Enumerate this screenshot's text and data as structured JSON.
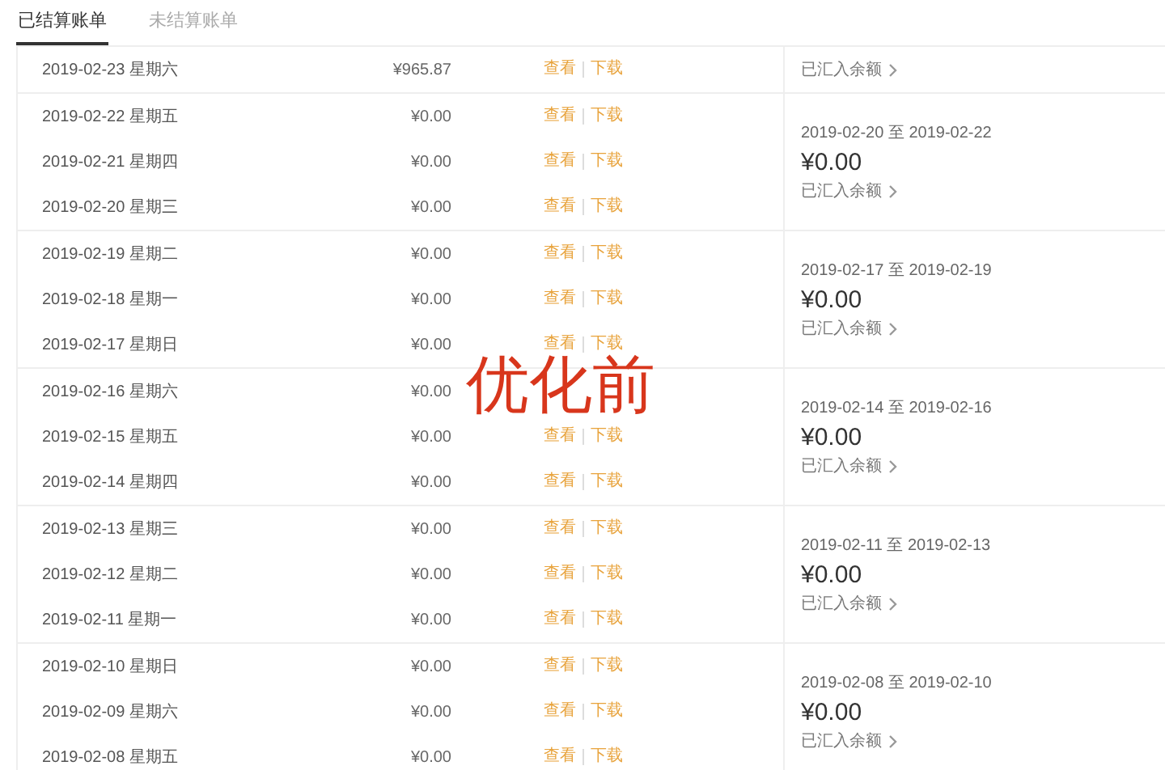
{
  "tabs": [
    {
      "label": "已结算账单",
      "selected": true
    },
    {
      "label": "未结算账单",
      "selected": false
    }
  ],
  "groups": [
    {
      "days": [
        {
          "date": "2019-02-23 星期六",
          "amount": "¥965.87",
          "actions": [
            "查看",
            "下载"
          ]
        }
      ],
      "summary": {
        "link": "已汇入余额"
      }
    },
    {
      "days": [
        {
          "date": "2019-02-22 星期五",
          "amount": "¥0.00",
          "actions": [
            "查看",
            "下载"
          ]
        },
        {
          "date": "2019-02-21 星期四",
          "amount": "¥0.00",
          "actions": [
            "查看",
            "下载"
          ]
        },
        {
          "date": "2019-02-20 星期三",
          "amount": "¥0.00",
          "actions": [
            "查看",
            "下载"
          ]
        }
      ],
      "summary": {
        "range": "2019-02-20 至 2019-02-22",
        "amount": "¥0.00",
        "link": "已汇入余额"
      }
    },
    {
      "days": [
        {
          "date": "2019-02-19 星期二",
          "amount": "¥0.00",
          "actions": [
            "查看",
            "下载"
          ]
        },
        {
          "date": "2019-02-18 星期一",
          "amount": "¥0.00",
          "actions": [
            "查看",
            "下载"
          ]
        },
        {
          "date": "2019-02-17 星期日",
          "amount": "¥0.00",
          "actions": [
            "查看",
            "下载"
          ]
        }
      ],
      "summary": {
        "range": "2019-02-17 至 2019-02-19",
        "amount": "¥0.00",
        "link": "已汇入余额"
      }
    },
    {
      "days": [
        {
          "date": "2019-02-16 星期六",
          "amount": "¥0.00"
        },
        {
          "date": "2019-02-15 星期五",
          "amount": "¥0.00",
          "actions": [
            "查看",
            "下载"
          ]
        },
        {
          "date": "2019-02-14 星期四",
          "amount": "¥0.00",
          "actions": [
            "查看",
            "下载"
          ]
        }
      ],
      "summary": {
        "range": "2019-02-14 至 2019-02-16",
        "amount": "¥0.00",
        "link": "已汇入余额"
      }
    },
    {
      "days": [
        {
          "date": "2019-02-13 星期三",
          "amount": "¥0.00",
          "actions": [
            "查看",
            "下载"
          ]
        },
        {
          "date": "2019-02-12 星期二",
          "amount": "¥0.00",
          "actions": [
            "查看",
            "下载"
          ]
        },
        {
          "date": "2019-02-11 星期一",
          "amount": "¥0.00",
          "actions": [
            "查看",
            "下载"
          ]
        }
      ],
      "summary": {
        "range": "2019-02-11 至 2019-02-13",
        "amount": "¥0.00",
        "link": "已汇入余额"
      }
    },
    {
      "days": [
        {
          "date": "2019-02-10 星期日",
          "amount": "¥0.00",
          "actions": [
            "查看",
            "下载"
          ]
        },
        {
          "date": "2019-02-09 星期六",
          "amount": "¥0.00",
          "actions": [
            "查看",
            "下载"
          ]
        },
        {
          "date": "2019-02-08 星期五",
          "amount": "¥0.00",
          "actions": [
            "查看",
            "下载"
          ]
        }
      ],
      "summary": {
        "range": "2019-02-08 至 2019-02-10",
        "amount": "¥0.00",
        "link": "已汇入余额"
      }
    }
  ],
  "overlay_label": "优化前"
}
